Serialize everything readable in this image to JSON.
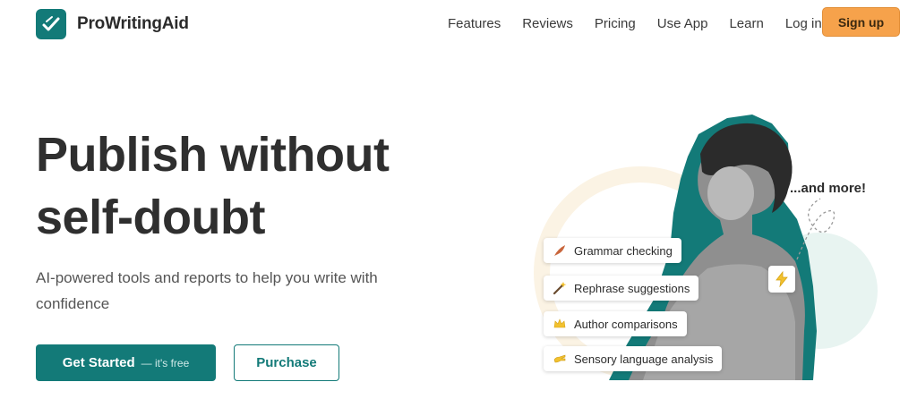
{
  "brand": {
    "name": "ProWritingAid",
    "logo_icon": "quill-check-icon",
    "color": "#137a78"
  },
  "nav": {
    "links": [
      "Features",
      "Reviews",
      "Pricing",
      "Use App",
      "Learn",
      "Log in"
    ],
    "signup_label": "Sign up",
    "signup_color": "#f6a24b"
  },
  "hero": {
    "headline_line1": "Publish without",
    "headline_line2": "self-doubt",
    "subheadline": "AI-powered tools and reports to help you write with confidence",
    "primary_cta": "Get Started",
    "primary_cta_note": "— it's free",
    "secondary_cta": "Purchase"
  },
  "illustration": {
    "feature_pills": [
      {
        "label": "Grammar checking",
        "icon": "feather-icon"
      },
      {
        "label": "Rephrase suggestions",
        "icon": "magic-wand-icon"
      },
      {
        "label": "Author comparisons",
        "icon": "crown-icon"
      },
      {
        "label": "Sensory language analysis",
        "icon": "hand-icon"
      }
    ],
    "callout": "...and more!",
    "bolt_icon": "lightning-icon"
  }
}
